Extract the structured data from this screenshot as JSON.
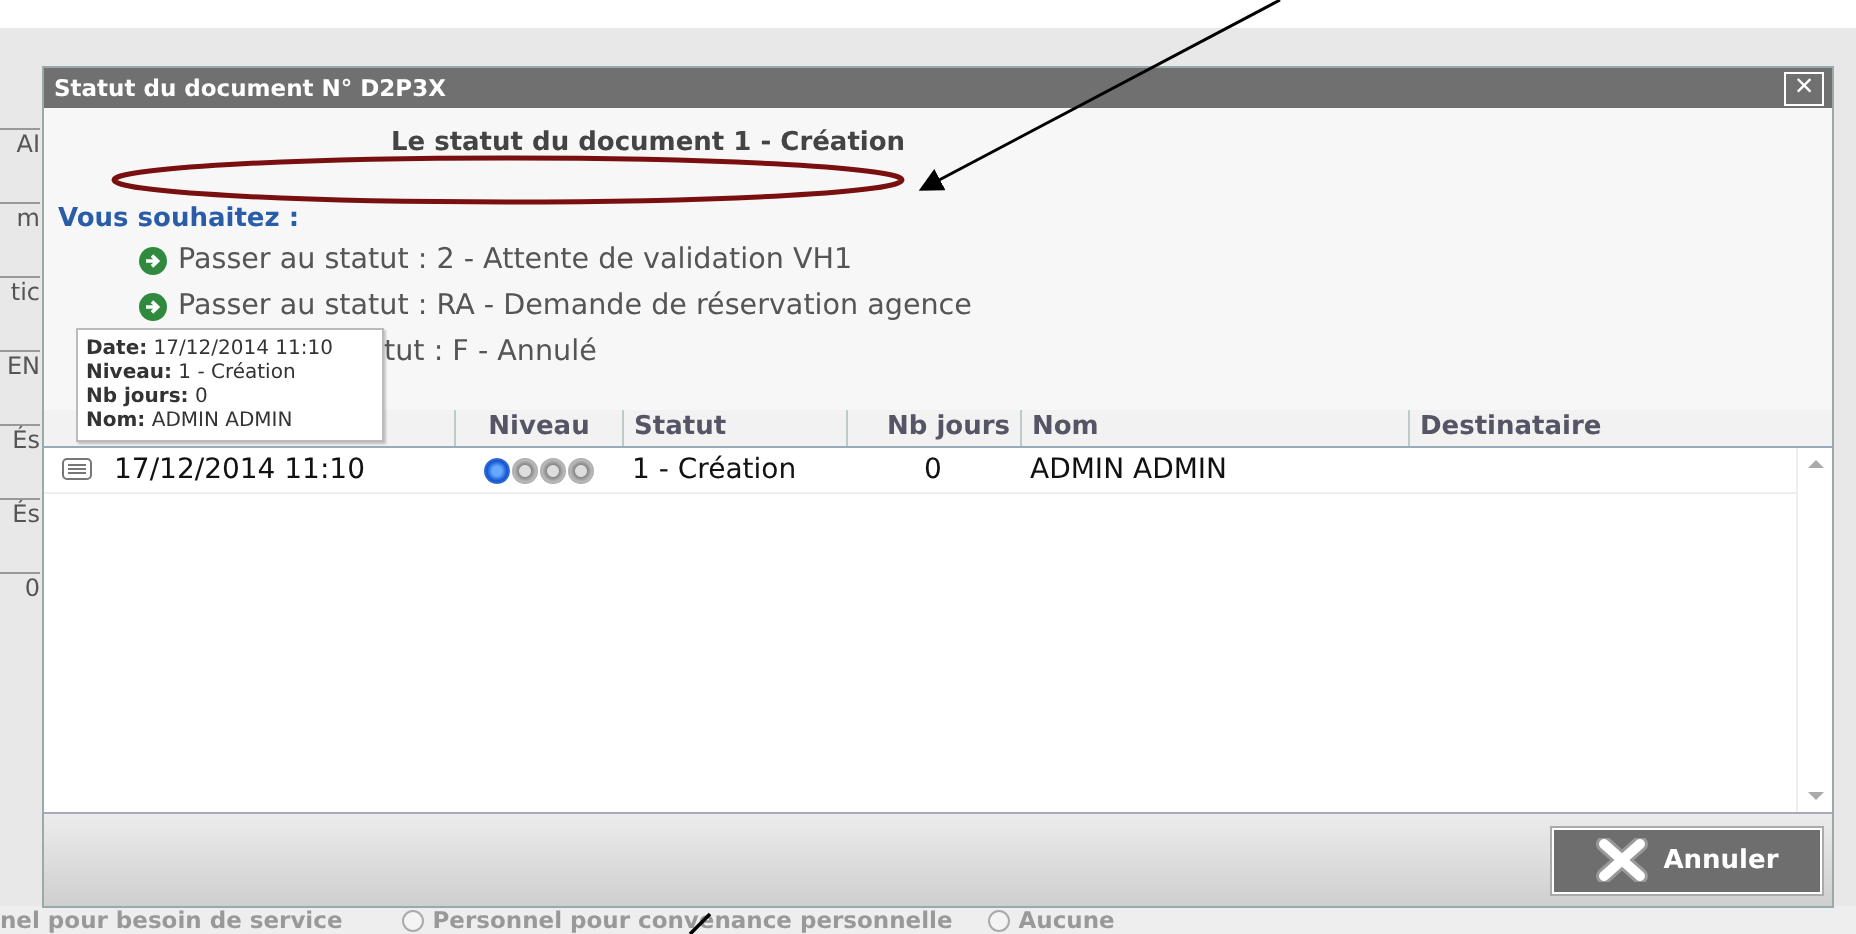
{
  "background_page": {
    "left_fragments": [
      "AI",
      "m",
      "tic",
      "EN",
      "És",
      "És",
      "0"
    ],
    "bottom_options": [
      {
        "kind": "text",
        "label": "nel pour besoin de service"
      },
      {
        "kind": "radio",
        "label": "Personnel pour convenance personnelle",
        "selected": false
      },
      {
        "kind": "radio",
        "label": "Aucune",
        "selected": false
      }
    ]
  },
  "dialog": {
    "title": "Statut du document N° D2P3X",
    "close": "×",
    "current_status": "Le statut du document 1 - Création",
    "choices_heading": "Vous souhaitez :",
    "choices": [
      {
        "kind": "full",
        "text": "Passer au statut : 2 - Attente de validation VH1"
      },
      {
        "kind": "full",
        "text": "Passer au statut : RA - Demande de réservation agence"
      },
      {
        "kind": "covered",
        "text": "tut : F - Annulé"
      }
    ],
    "table": {
      "columns": [
        "",
        "Niveau",
        "Statut",
        "Nb jours",
        "Nom",
        "Destinataire"
      ],
      "rows": [
        {
          "date": "17/12/2014 11:10",
          "level_steps": [
            {
              "on": true
            },
            {
              "on": false
            },
            {
              "on": false
            },
            {
              "on": false
            }
          ],
          "statut": "1 - Création",
          "nb_jours": "0",
          "nom": "ADMIN ADMIN",
          "destinataire": ""
        }
      ]
    },
    "tooltip": [
      {
        "label": "Date:",
        "value": "17/12/2014 11:10"
      },
      {
        "label": "Niveau:",
        "value": "1 - Création"
      },
      {
        "label": "Nb jours:",
        "value": "0"
      },
      {
        "label": "Nom:",
        "value": "ADMIN ADMIN"
      }
    ],
    "buttons": [
      {
        "kind": "cancel",
        "label": "Annuler"
      }
    ]
  }
}
